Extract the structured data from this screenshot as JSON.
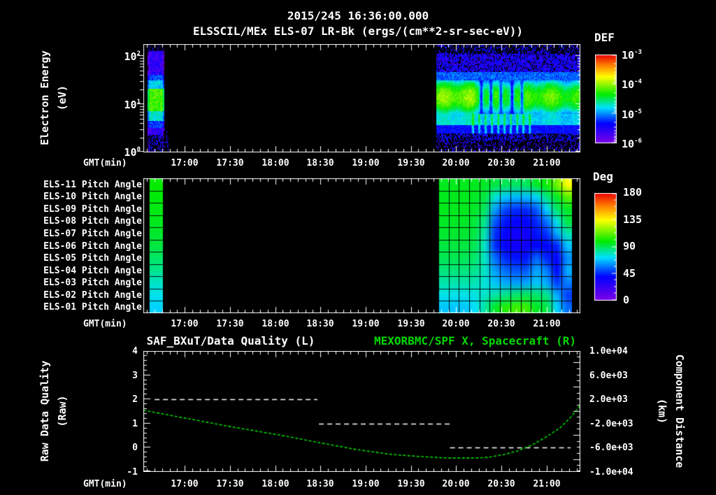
{
  "header": {
    "title": "2015/245 16:36:00.000",
    "subtitle": "ELSSCIL/MEx ELS-07 LR-Bk  (ergs/(cm**2-sr-sec-eV))"
  },
  "time_axis": {
    "label": "GMT(min)",
    "tick_labels": [
      "17:00",
      "17:30",
      "18:00",
      "18:30",
      "19:00",
      "19:30",
      "20:00",
      "20:30",
      "21:00"
    ],
    "range_min": [
      992.5,
      1282.5
    ],
    "major_tick_start_min": 1020,
    "major_tick_step_min": 30,
    "minor_tick_step_min": 5
  },
  "colors": {
    "foreground": "#ffffff",
    "background": "#000000",
    "accent_green": "#00d800",
    "grid_line": "#000000",
    "colormap": [
      [
        0,
        125,
        0,
        230
      ],
      [
        0.22,
        0,
        0,
        255
      ],
      [
        0.4,
        0,
        225,
        255
      ],
      [
        0.55,
        0,
        235,
        0
      ],
      [
        0.75,
        255,
        255,
        0
      ],
      [
        0.88,
        255,
        130,
        0
      ],
      [
        1,
        235,
        0,
        0
      ]
    ]
  },
  "chart_data": [
    {
      "id": "electron-energy-spectrogram",
      "type": "heatmap",
      "ylabel1": "Electron Energy",
      "ylabel2": "(eV)",
      "y_scale": "log",
      "y_tick_base": "10",
      "y_tick_exponents": [
        "2",
        "1",
        "0"
      ],
      "colorbar": {
        "title": "DEF",
        "tick_base": "10",
        "tick_exponents": [
          "-3",
          "-4",
          "-5",
          "-6"
        ],
        "flux_log_range": [
          -6.2,
          -3.0
        ]
      },
      "segments": [
        {
          "name": "first-pass",
          "t_start_min": 995.5,
          "t_end_min": 1006,
          "bands": [
            [
              2.12,
              2.3,
              -9,
              0.18
            ],
            [
              1.62,
              2.12,
              -5.8,
              0.3
            ],
            [
              1.5,
              1.62,
              -5.3,
              0.2
            ],
            [
              1.32,
              1.5,
              -4.95,
              0.2
            ],
            [
              0.86,
              1.32,
              -4.28,
              0.18
            ],
            [
              0.68,
              0.86,
              -4.85,
              0.2
            ],
            [
              0.52,
              0.68,
              -5.35,
              0.25
            ],
            [
              0.38,
              0.52,
              -5.75,
              0.25
            ],
            [
              0.0,
              0.38,
              -9,
              0.45
            ]
          ]
        },
        {
          "name": "second-pass",
          "t_start_min": 1187,
          "t_end_min": 1282.5,
          "band_center_exp": 1.16,
          "band_width_exp": 0.34,
          "band_flux": -4.32,
          "notch_centers_min": [
            1216.5,
            1223,
            1229.5,
            1237,
            1243.5
          ],
          "disturbed_window_min": [
            1210,
            1252
          ]
        }
      ]
    },
    {
      "id": "pitch-angle-panel",
      "type": "heatmap",
      "row_labels": [
        "ELS-11 Pitch Angle",
        "ELS-10 Pitch Angle",
        "ELS-09 Pitch Angle",
        "ELS-08 Pitch Angle",
        "ELS-07 Pitch Angle",
        "ELS-06 Pitch Angle",
        "ELS-05 Pitch Angle",
        "ELS-04 Pitch Angle",
        "ELS-03 Pitch Angle",
        "ELS-02 Pitch Angle",
        "ELS-01 Pitch Angle"
      ],
      "colorbar": {
        "title": "Deg",
        "ticks": [
          "180",
          "135",
          "90",
          "45",
          "0"
        ],
        "range_deg": [
          0,
          180
        ]
      },
      "early_band": {
        "t_start_min": 996.3,
        "t_end_min": 1005.5,
        "values_deg": [
          100,
          98,
          97,
          96,
          94,
          92,
          88,
          84,
          78,
          74,
          70
        ]
      },
      "main_block": {
        "t_start_min": 1188.3,
        "t_end_min": 1276.9,
        "columns": 13,
        "values_deg": [
          [
            96,
            96,
            96,
            96,
            95,
            92,
            90,
            89,
            89,
            95,
            100,
            115,
            135
          ],
          [
            96,
            96,
            96,
            95,
            92,
            76,
            68,
            66,
            66,
            70,
            85,
            95,
            112
          ],
          [
            96,
            96,
            96,
            95,
            89,
            62,
            50,
            46,
            46,
            52,
            70,
            88,
            95
          ],
          [
            95,
            95,
            95,
            93,
            84,
            52,
            42,
            38,
            38,
            45,
            56,
            75,
            92
          ],
          [
            94,
            94,
            94,
            92,
            80,
            46,
            37,
            34,
            34,
            42,
            46,
            64,
            80
          ],
          [
            92,
            92,
            92,
            90,
            78,
            46,
            37,
            34,
            34,
            40,
            38,
            45,
            68
          ],
          [
            90,
            90,
            90,
            88,
            78,
            55,
            45,
            42,
            42,
            55,
            45,
            38,
            60
          ],
          [
            86,
            86,
            86,
            84,
            78,
            62,
            55,
            52,
            52,
            64,
            58,
            40,
            65
          ],
          [
            81,
            81,
            81,
            80,
            76,
            68,
            64,
            62,
            63,
            68,
            64,
            48,
            58
          ],
          [
            74,
            74,
            74,
            75,
            78,
            82,
            85,
            88,
            90,
            88,
            85,
            65,
            48
          ],
          [
            68,
            68,
            68,
            72,
            82,
            95,
            104,
            108,
            108,
            95,
            92,
            70,
            55
          ]
        ]
      }
    },
    {
      "id": "quality-distance-timeseries",
      "type": "line",
      "title_left": "SAF_BXuT/Data Quality (L)",
      "title_right": "MEXORBMC/SPF X, Spacecraft (R)",
      "ylabel_left1": "Raw Data Quality",
      "ylabel_left2": "(Raw)",
      "ylabel_right1": "Component Distance",
      "ylabel_right2": "(km)",
      "left_axis": {
        "range": [
          -1,
          4
        ],
        "tick_labels": [
          "4",
          "3",
          "2",
          "1",
          "0",
          "-1"
        ],
        "minor_step": 0.2
      },
      "right_axis": {
        "range": [
          -10000,
          10000
        ],
        "tick_labels": [
          "1.0e+04",
          "6.0e+03",
          "2.0e+03",
          "-2.0e+03",
          "-6.0e+03",
          "-1.0e+04"
        ],
        "minor_step": 1000
      },
      "series": [
        {
          "name": "SAF_BXuT/Data Quality (L)",
          "axis": "left",
          "style": "dashed",
          "color": "#ffffff",
          "steps": [
            [
              [
                1000,
                2
              ],
              [
                1108,
                2
              ]
            ],
            [
              [
                1109,
                1
              ],
              [
                1196,
                1
              ]
            ],
            [
              [
                1196,
                0
              ],
              [
                1276,
                0
              ]
            ]
          ]
        },
        {
          "name": "MEXORBMC/SPF X, Spacecraft (R)",
          "axis": "right",
          "style": "dashed-fine",
          "color": "#00d800",
          "points": [
            [
              992.5,
              200
            ],
            [
              1018,
              -1000
            ],
            [
              1050,
              -2500
            ],
            [
              1083,
              -3900
            ],
            [
              1108,
              -5100
            ],
            [
              1134,
              -6300
            ],
            [
              1157,
              -7100
            ],
            [
              1176,
              -7450
            ],
            [
              1194,
              -7700
            ],
            [
              1213,
              -7700
            ],
            [
              1222,
              -7570
            ],
            [
              1232,
              -7100
            ],
            [
              1241,
              -6530
            ],
            [
              1250,
              -5600
            ],
            [
              1259,
              -4340
            ],
            [
              1269,
              -2720
            ],
            [
              1276,
              -980
            ],
            [
              1282.5,
              1000
            ]
          ]
        }
      ]
    }
  ]
}
